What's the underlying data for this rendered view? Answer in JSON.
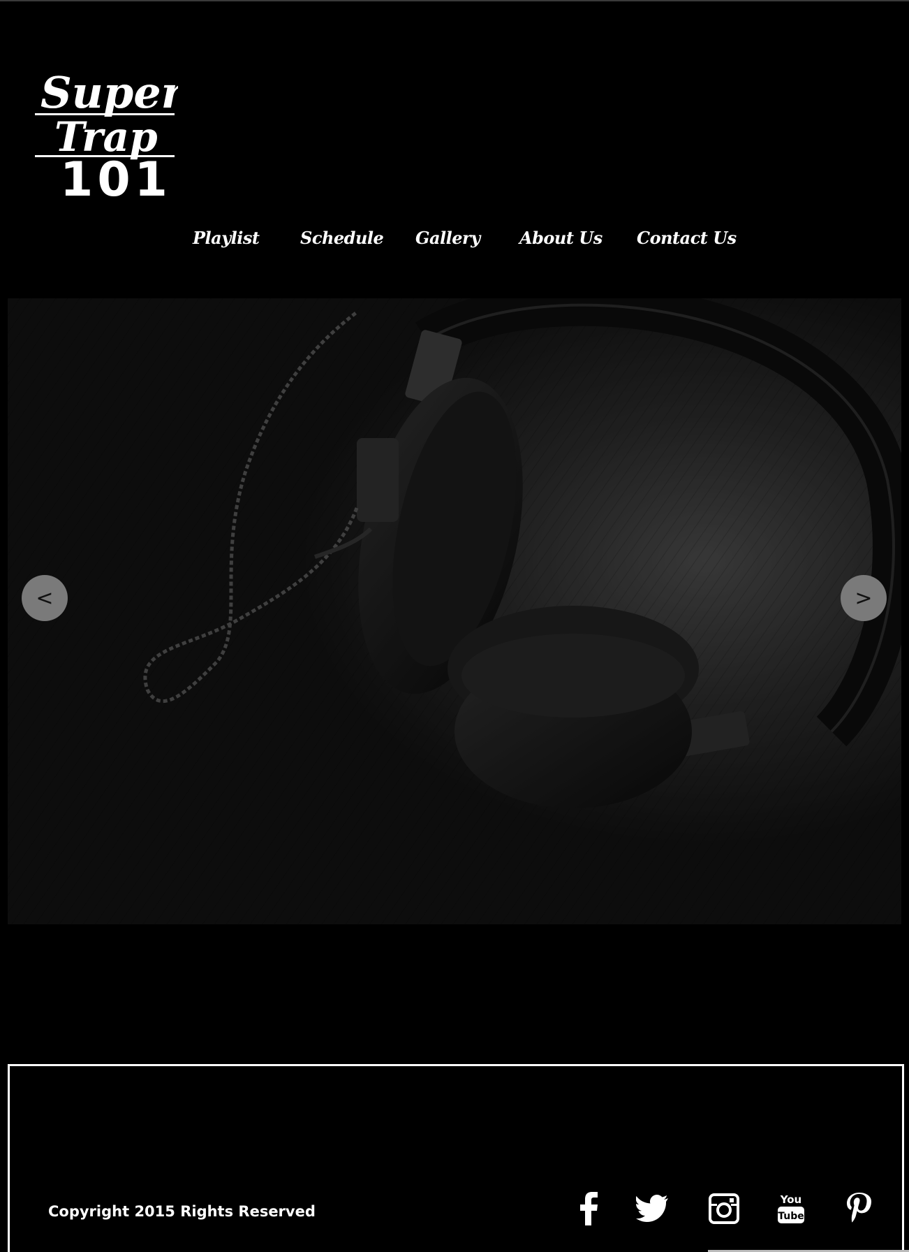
{
  "logo": {
    "line1": "Super",
    "line2": "Trap",
    "line3": "101"
  },
  "nav": {
    "items": [
      {
        "label": "Playlist"
      },
      {
        "label": "Schedule"
      },
      {
        "label": "Gallery"
      },
      {
        "label": "About Us"
      },
      {
        "label": "Contact Us"
      }
    ]
  },
  "slider": {
    "prev_label": "<",
    "next_label": ">",
    "image": "headphones-photo"
  },
  "footer": {
    "copyright": "Copyright 2015 Rights Reserved",
    "social": [
      {
        "icon": "facebook-icon"
      },
      {
        "icon": "twitter-icon"
      },
      {
        "icon": "instagram-icon"
      },
      {
        "icon": "youtube-icon",
        "line1": "You",
        "line2": "Tube"
      },
      {
        "icon": "pinterest-icon"
      }
    ]
  },
  "colors": {
    "background": "#000000",
    "text": "#ffffff",
    "arrow_bg": "#7a7a7a"
  }
}
